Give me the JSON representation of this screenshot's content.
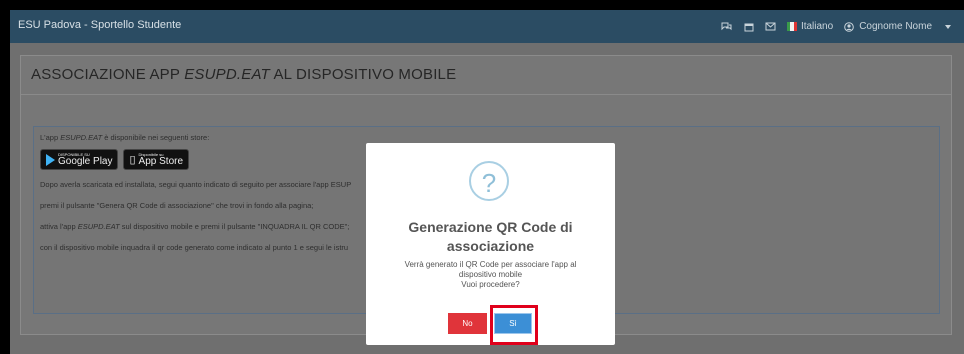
{
  "header": {
    "brand": "ESU Padova - Sportello Studente",
    "language": "Italiano",
    "user_name": "Cognome Nome",
    "icons": [
      "chat-icon",
      "calendar-icon",
      "mail-icon",
      "flag-it-icon",
      "user-icon",
      "chevron-down-icon"
    ]
  },
  "page": {
    "title_prefix": "ASSOCIAZIONE APP ",
    "title_app": "ESUPD.EAT",
    "title_suffix": " AL DISPOSITIVO MOBILE"
  },
  "content": {
    "l1_a": "L'app ",
    "l1_app": "ESUPD.EAT",
    "l1_b": " è disponibile nei seguenti store:",
    "google_small": "DISPONIBILE SU",
    "google_big": "Google Play",
    "apple_small": "Disponibile su",
    "apple_big": "App Store",
    "l2": "Dopo averla scaricata ed installata, segui quanto indicato di seguito per associare l'app ESUP",
    "l3": "premi il pulsante \"Genera QR Code di associazione\" che trovi in fondo alla pagina;",
    "l4_a": "attiva l'app ",
    "l4_app": "ESUPD.EAT",
    "l4_b": " sul dispositivo mobile e premi il pulsante \"INQUADRA IL QR CODE\";",
    "l5": "con il dispositivo mobile inquadra il qr code generato come indicato al punto 1 e segui le istru"
  },
  "modal": {
    "icon_glyph": "?",
    "title_line1": "Generazione QR Code di",
    "title_line2": "associazione",
    "text_line1": "Verrà generato il QR Code per associare l'app al",
    "text_line2": "dispositivo mobile",
    "text_line3": "Vuoi procedere?",
    "no_label": "No",
    "si_label": "Sì"
  },
  "colors": {
    "topbar": "#2b4c63",
    "no_button": "#e0343a",
    "si_button": "#3c8fd6",
    "highlight": "#e0001b"
  }
}
